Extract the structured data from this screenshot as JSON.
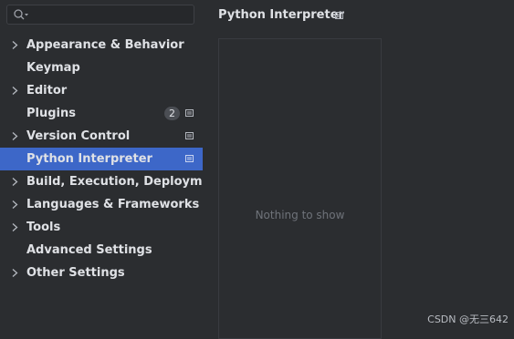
{
  "search": {
    "placeholder": ""
  },
  "sidebar": {
    "items": [
      {
        "label": "Appearance & Behavior",
        "expandable": true
      },
      {
        "label": "Keymap",
        "expandable": false
      },
      {
        "label": "Editor",
        "expandable": true
      },
      {
        "label": "Plugins",
        "expandable": false,
        "badge": "2",
        "project_icon": true
      },
      {
        "label": "Version Control",
        "expandable": true,
        "project_icon": true
      },
      {
        "label": "Python Interpreter",
        "expandable": false,
        "project_icon": true,
        "selected": true
      },
      {
        "label": "Build, Execution, Deployment",
        "expandable": true
      },
      {
        "label": "Languages & Frameworks",
        "expandable": true
      },
      {
        "label": "Tools",
        "expandable": true
      },
      {
        "label": "Advanced Settings",
        "expandable": false
      },
      {
        "label": "Other Settings",
        "expandable": true
      }
    ]
  },
  "main": {
    "title": "Python Interpreter",
    "empty_text": "Nothing to show"
  },
  "watermark": "CSDN @无三642",
  "colors": {
    "background": "#2b2d30",
    "selection": "#3d67c8",
    "text": "#dfe1e5",
    "muted_text": "#6f737a"
  },
  "icons": {
    "search": "magnifier-with-dropdown-icon",
    "expand": "chevron-right-icon",
    "project_scope": "project-scope-icon"
  }
}
